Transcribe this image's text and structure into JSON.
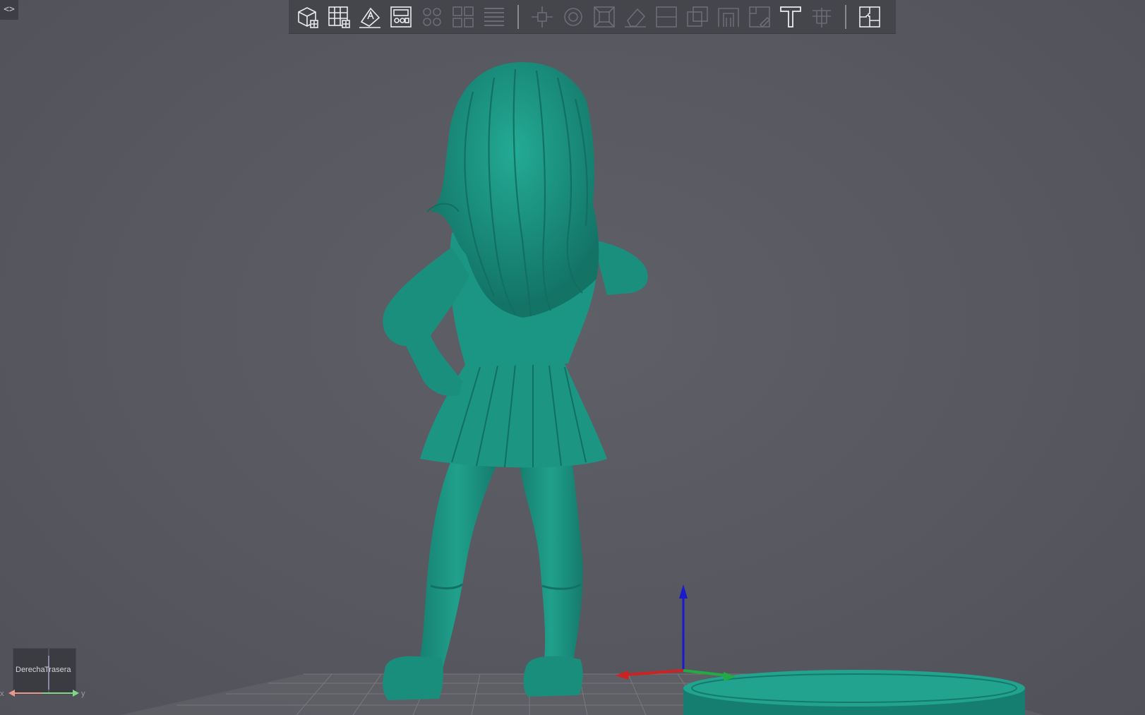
{
  "app": {
    "sidebar_toggle_label": "<>"
  },
  "toolbar": {
    "groups": [
      [
        "add-model",
        "grid-layout",
        "auto-orient",
        "arrange"
      ],
      [
        "hollow",
        "duplicate",
        "slice-stack"
      ],
      [
        "move",
        "rotate",
        "scale",
        "erase",
        "cut",
        "boolean",
        "support-bridge",
        "support-edit",
        "text",
        "drill"
      ],
      [
        "split-puzzle"
      ]
    ]
  },
  "viewcube": {
    "face_right": "Derecha",
    "face_back": "Trasera",
    "axis_x": "x",
    "axis_y": "y"
  },
  "colors": {
    "background": "#595961",
    "model": "#1d9c89",
    "model_shadow": "#137163",
    "toolbar": "#45454c",
    "axis_x": "#cc2222",
    "axis_y": "#22aa44",
    "axis_z": "#1a1acc"
  }
}
